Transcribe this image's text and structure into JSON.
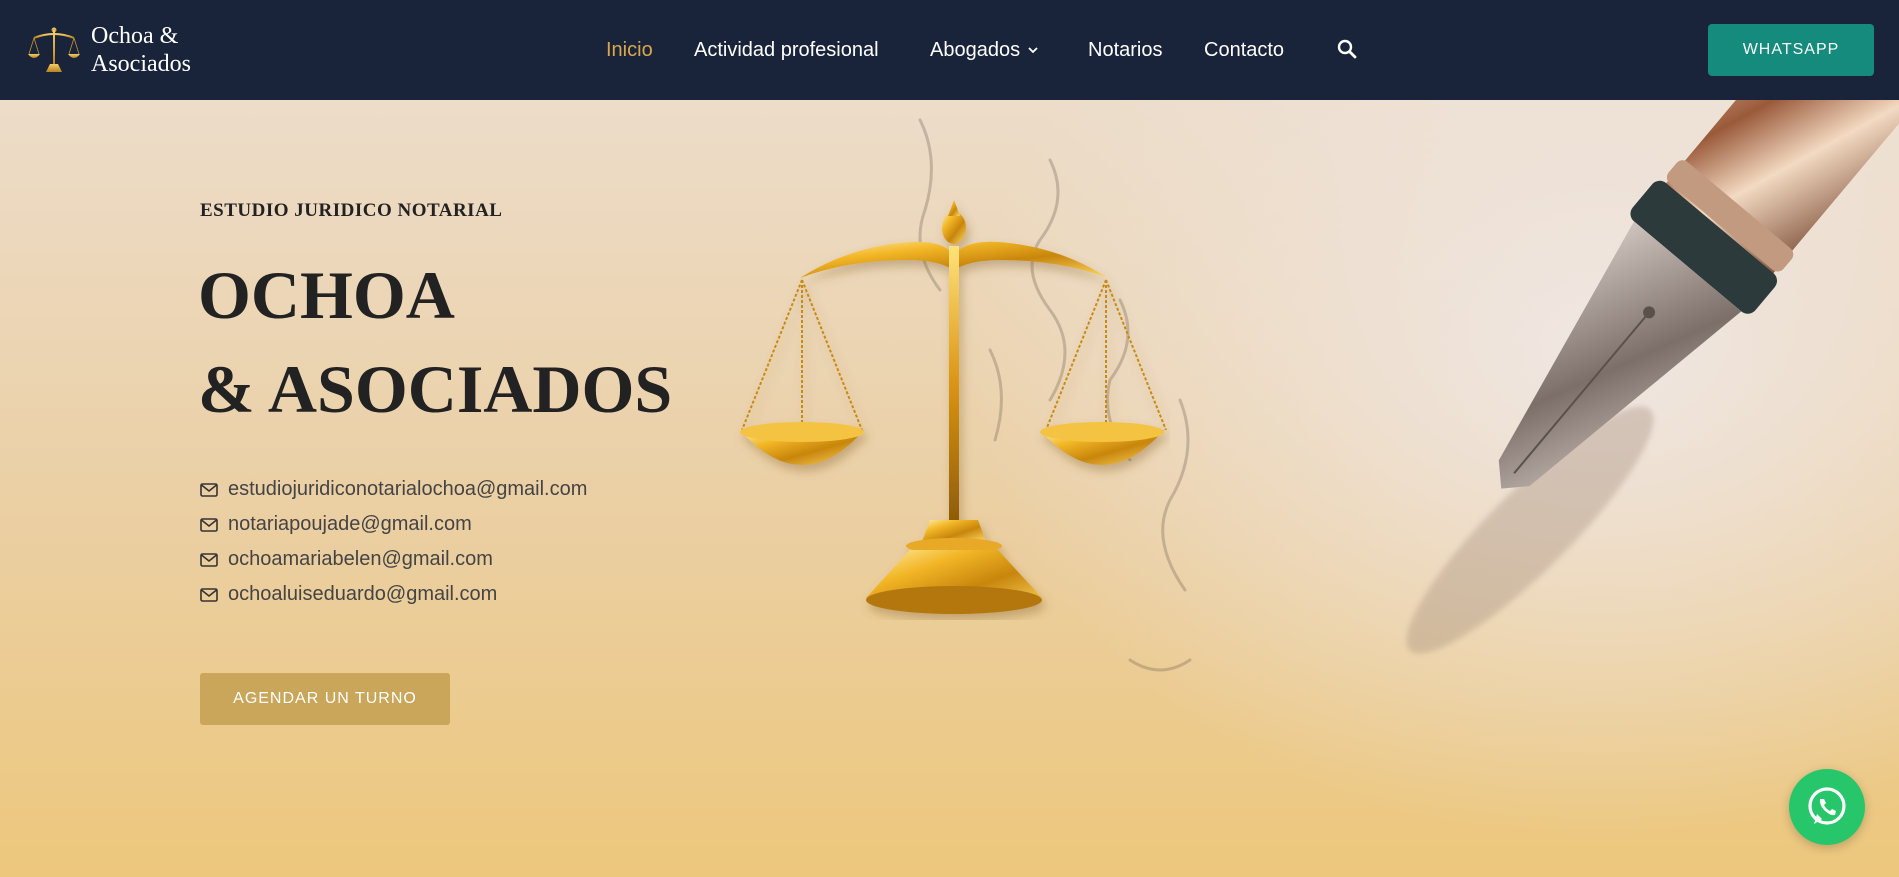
{
  "header": {
    "logo_text": "Ochoa &\nAsociados",
    "nav": [
      {
        "label": "Inicio",
        "active": true
      },
      {
        "label": "Actividad profesional"
      },
      {
        "label": "Abogados",
        "has_dropdown": true
      },
      {
        "label": "Notarios"
      },
      {
        "label": "Contacto"
      }
    ],
    "search_icon": "search-icon",
    "whatsapp_label": "WHATSAPP"
  },
  "hero": {
    "kicker": "ESTUDIO JURIDICO NOTARIAL",
    "title_line1": "OCHOA",
    "title_line2": "& ASOCIADOS",
    "emails": [
      "estudiojuridiconotarialochoa@gmail.com",
      "notariapoujade@gmail.com",
      "ochoamariabelen@gmail.com",
      "ochoaluiseduardo@gmail.com"
    ],
    "cta_label": "AGENDAR UN TURNO"
  },
  "colors": {
    "header_bg": "#19243a",
    "nav_active": "#d9a84c",
    "whatsapp_btn": "#158b7d",
    "cta_btn": "#c9a659",
    "whatsapp_float": "#27c66a"
  }
}
